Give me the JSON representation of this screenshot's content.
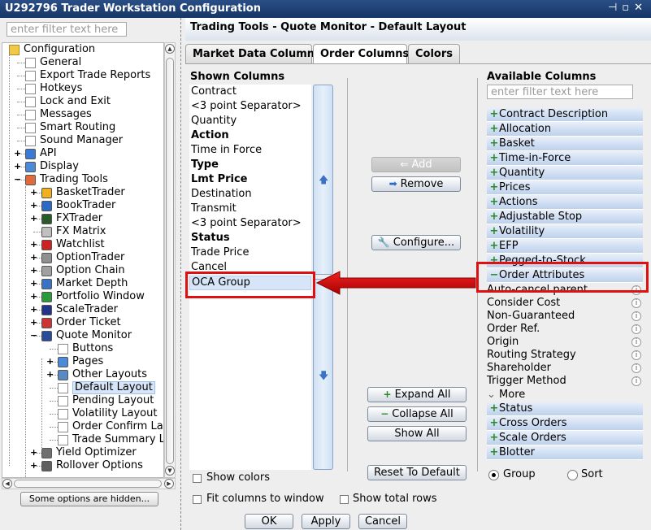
{
  "window": {
    "title": "U292796 Trader Workstation Configuration"
  },
  "left": {
    "filter_placeholder": "enter filter text here",
    "hidden_button": "Some options are hidden..."
  },
  "tree": [
    {
      "label": "Configuration",
      "level": 0,
      "icon": "folder-icon",
      "expander": ""
    },
    {
      "label": "General",
      "level": 1,
      "icon": "document-icon",
      "expander": ""
    },
    {
      "label": "Export Trade Reports",
      "level": 1,
      "icon": "document-icon",
      "expander": ""
    },
    {
      "label": "Hotkeys",
      "level": 1,
      "icon": "document-icon",
      "expander": ""
    },
    {
      "label": "Lock and Exit",
      "level": 1,
      "icon": "document-icon",
      "expander": ""
    },
    {
      "label": "Messages",
      "level": 1,
      "icon": "document-icon",
      "expander": ""
    },
    {
      "label": "Smart Routing",
      "level": 1,
      "icon": "document-icon",
      "expander": ""
    },
    {
      "label": "Sound Manager",
      "level": 1,
      "icon": "document-icon",
      "expander": ""
    },
    {
      "label": "API",
      "level": 1,
      "icon": "api-icon",
      "expander": "+"
    },
    {
      "label": "Display",
      "level": 1,
      "icon": "display-icon",
      "expander": "+"
    },
    {
      "label": "Trading Tools",
      "level": 1,
      "icon": "trading-tools-icon",
      "expander": "-"
    },
    {
      "label": "BasketTrader",
      "level": 2,
      "icon": "basket-icon",
      "expander": "+"
    },
    {
      "label": "BookTrader",
      "level": 2,
      "icon": "book-icon",
      "expander": "+"
    },
    {
      "label": "FXTrader",
      "level": 2,
      "icon": "fx-icon",
      "expander": "+"
    },
    {
      "label": "FX Matrix",
      "level": 2,
      "icon": "fx-matrix-icon",
      "expander": ""
    },
    {
      "label": "Watchlist",
      "level": 2,
      "icon": "watchlist-icon",
      "expander": "+"
    },
    {
      "label": "OptionTrader",
      "level": 2,
      "icon": "option-icon",
      "expander": "+"
    },
    {
      "label": "Option Chain",
      "level": 2,
      "icon": "option-chain-icon",
      "expander": "+"
    },
    {
      "label": "Market Depth",
      "level": 2,
      "icon": "market-depth-icon",
      "expander": "+"
    },
    {
      "label": "Portfolio Window",
      "level": 2,
      "icon": "portfolio-icon",
      "expander": "+"
    },
    {
      "label": "ScaleTrader",
      "level": 2,
      "icon": "scale-icon",
      "expander": "+"
    },
    {
      "label": "Order Ticket",
      "level": 2,
      "icon": "order-ticket-icon",
      "expander": "+"
    },
    {
      "label": "Quote Monitor",
      "level": 2,
      "icon": "quote-monitor-icon",
      "expander": "-"
    },
    {
      "label": "Buttons",
      "level": 3,
      "icon": "document-icon",
      "expander": ""
    },
    {
      "label": "Pages",
      "level": 3,
      "icon": "pages-icon",
      "expander": "+"
    },
    {
      "label": "Other Layouts",
      "level": 3,
      "icon": "layouts-icon",
      "expander": "+"
    },
    {
      "label": "Default Layout",
      "level": 3,
      "icon": "document-icon",
      "expander": "",
      "selected": true
    },
    {
      "label": "Pending Layout",
      "level": 3,
      "icon": "document-icon",
      "expander": ""
    },
    {
      "label": "Volatility Layout",
      "level": 3,
      "icon": "document-icon",
      "expander": ""
    },
    {
      "label": "Order Confirm Layo",
      "level": 3,
      "icon": "document-icon",
      "expander": ""
    },
    {
      "label": "Trade Summary La",
      "level": 3,
      "icon": "document-icon",
      "expander": ""
    },
    {
      "label": "Yield Optimizer",
      "level": 2,
      "icon": "yield-icon",
      "expander": "+"
    },
    {
      "label": "Rollover Options",
      "level": 2,
      "icon": "rollover-icon",
      "expander": "+"
    }
  ],
  "header": {
    "title": "Trading Tools - Quote Monitor - Default Layout"
  },
  "tabs": [
    {
      "label": "Market Data Columns",
      "active": false
    },
    {
      "label": "Order Columns",
      "active": true
    },
    {
      "label": "Colors",
      "active": false
    }
  ],
  "shown": {
    "title": "Shown Columns",
    "items": [
      {
        "label": "Contract",
        "bold": false
      },
      {
        "label": "<3 point Separator>",
        "bold": false
      },
      {
        "label": "Quantity",
        "bold": false
      },
      {
        "label": "Action",
        "bold": true
      },
      {
        "label": "Time in Force",
        "bold": false
      },
      {
        "label": "Type",
        "bold": true
      },
      {
        "label": "Lmt Price",
        "bold": true
      },
      {
        "label": "Destination",
        "bold": false
      },
      {
        "label": "Transmit",
        "bold": false
      },
      {
        "label": "<3 point Separator>",
        "bold": false
      },
      {
        "label": "Status",
        "bold": true
      },
      {
        "label": "Trade Price",
        "bold": false
      },
      {
        "label": "Cancel",
        "bold": false
      }
    ],
    "selected_item": "OCA Group"
  },
  "middle": {
    "add": "Add",
    "remove": "Remove",
    "configure": "Configure...",
    "expand_all": "Expand All",
    "collapse_all": "Collapse All",
    "show_all": "Show All",
    "reset": "Reset To Default"
  },
  "available": {
    "title": "Available Columns",
    "filter_placeholder": "enter filter text here",
    "groups_top": [
      "Contract Description",
      "Allocation",
      "Basket",
      "Time-in-Force",
      "Quantity",
      "Prices",
      "Actions",
      "Adjustable Stop",
      "Volatility",
      "EFP",
      "Pegged-to-Stock"
    ],
    "expanded_group": "Order Attributes",
    "expanded_items": [
      "Auto-cancel parent",
      "Consider Cost",
      "Non-Guaranteed",
      "Order Ref.",
      "Origin",
      "Routing Strategy",
      "Shareholder",
      "Trigger Method"
    ],
    "more": "More",
    "groups_bottom": [
      "Status",
      "Cross Orders",
      "Scale Orders",
      "Blotter"
    ],
    "group_radio": "Group",
    "sort_radio": "Sort"
  },
  "options": {
    "show_colors": "Show colors",
    "fit_columns": "Fit columns to window",
    "show_total_rows": "Show total rows"
  },
  "footer": {
    "ok": "OK",
    "apply": "Apply",
    "cancel": "Cancel"
  }
}
